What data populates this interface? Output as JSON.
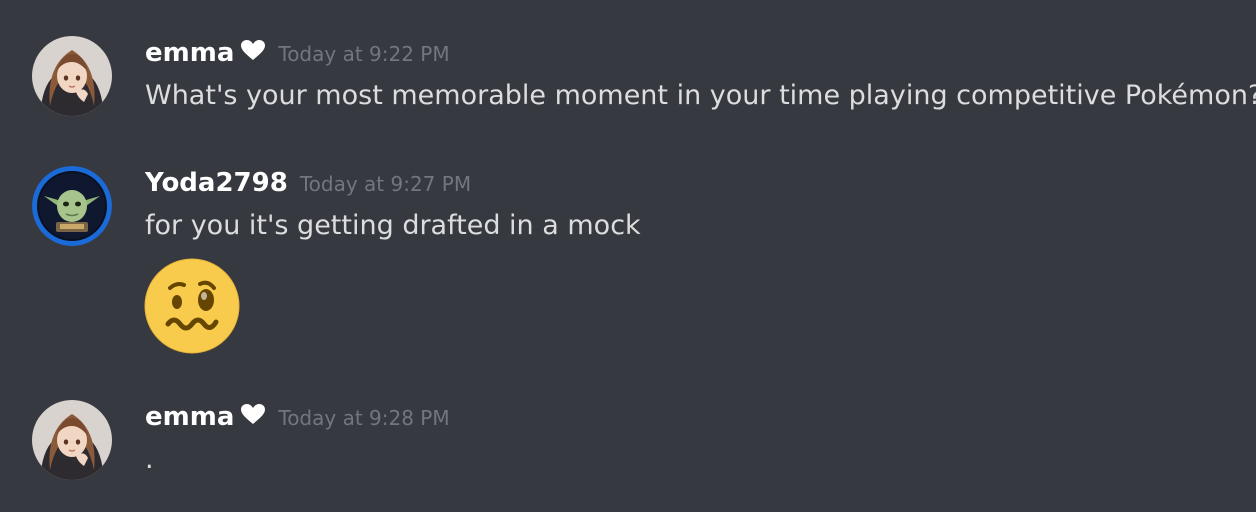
{
  "messages": [
    {
      "username": "emma",
      "username_suffix_icon": "heart-icon",
      "timestamp": "Today at 9:22 PM",
      "content": "What's your most memorable moment in your time playing competitive Pokémon?"
    },
    {
      "username": "Yoda2798",
      "timestamp": "Today at 9:27 PM",
      "content": "for you it's getting drafted in a mock",
      "emoji": "woozy-face-emoji"
    },
    {
      "username": "emma",
      "username_suffix_icon": "heart-icon",
      "timestamp": "Today at 9:28 PM",
      "content": "."
    }
  ],
  "colors": {
    "background": "#36393f",
    "username": "#ffffff",
    "timestamp": "#72767d",
    "message_text": "#dcddde",
    "yoda_avatar_ring": "#1a6bd8"
  }
}
